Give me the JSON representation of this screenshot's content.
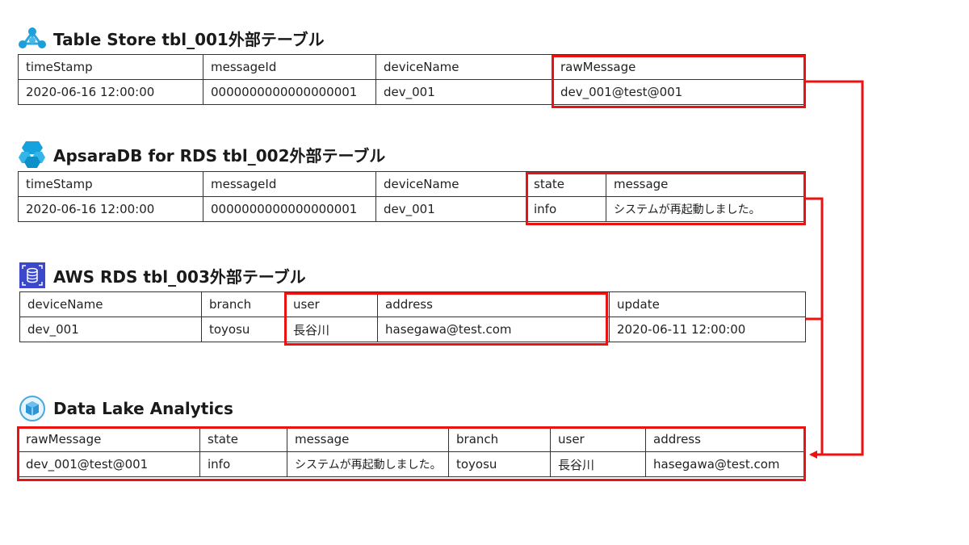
{
  "colors": {
    "highlight": "#ee1111",
    "grid": "#333333",
    "text": "#222222"
  },
  "sections": [
    {
      "id": "ts",
      "title": "Table Store tbl_001外部テーブル",
      "icon": "tablestore-network-icon",
      "columns": [
        "timeStamp",
        "messageId",
        "deviceName",
        "rawMessage"
      ],
      "row": [
        "2020-06-16 12:00:00",
        "0000000000000000001",
        "dev_001",
        "dev_001@test@001"
      ]
    },
    {
      "id": "rds",
      "title": "ApsaraDB for RDS tbl_002外部テーブル",
      "icon": "apsaradb-hexagon-icon",
      "columns": [
        "timeStamp",
        "messageId",
        "deviceName",
        "state",
        "message"
      ],
      "row": [
        "2020-06-16 12:00:00",
        "0000000000000000001",
        "dev_001",
        "info",
        "システムが再起動しました。"
      ]
    },
    {
      "id": "aws",
      "title": "AWS RDS tbl_003外部テーブル",
      "icon": "aws-rds-database-icon",
      "columns": [
        "deviceName",
        "branch",
        "user",
        "address",
        "update"
      ],
      "row": [
        "dev_001",
        "toyosu",
        "長谷川",
        "hasegawa@test.com",
        "2020-06-11 12:00:00"
      ]
    },
    {
      "id": "dla",
      "title": "Data Lake Analytics",
      "icon": "data-lake-cube-icon",
      "columns": [
        "rawMessage",
        "state",
        "message",
        "branch",
        "user",
        "address"
      ],
      "row": [
        "dev_001@test@001",
        "info",
        "システムが再起動しました。",
        "toyosu",
        "長谷川",
        "hasegawa@test.com"
      ]
    }
  ]
}
